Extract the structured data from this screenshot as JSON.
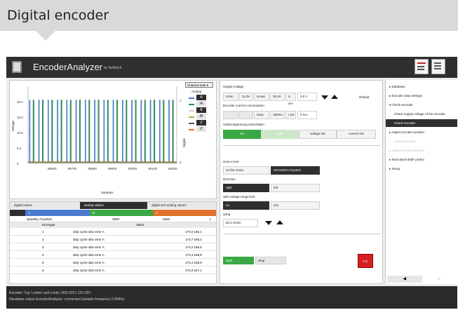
{
  "banner": {
    "title": "Digital encoder"
  },
  "app": {
    "name": "EncoderAnalyzer",
    "by": "by Schleich"
  },
  "plot": {
    "channel_select": "Channel sele ▾",
    "legend_title": "Analog",
    "y_label": "Voltage",
    "x_label": "Samples",
    "right_label": "Digital",
    "legend": [
      {
        "label": "A",
        "color": "#4a7bd0"
      },
      {
        "label": "/A",
        "color": "#2e8b57"
      },
      {
        "label": "B",
        "color": "#cfcfcf"
      },
      {
        "label": "/B",
        "color": "#8fbc3f"
      },
      {
        "label": "Z",
        "color": "#555555"
      },
      {
        "label": "/Z",
        "color": "#e0702a"
      }
    ]
  },
  "chart_data": {
    "type": "line",
    "xlabel": "Samples",
    "ylabel": "Voltage",
    "ylim": [
      0,
      25
    ],
    "yticks": [
      "20.0",
      "15.0",
      "10.0",
      "5.0",
      "0"
    ],
    "xticks": [
      "89600",
      "89700",
      "89800",
      "89900",
      "90000",
      "90100",
      "90200"
    ],
    "right_ticks": [
      "1",
      "0"
    ],
    "series": [
      {
        "name": "A",
        "color": "#4a7bd0",
        "low": 0.3,
        "high": 20.5,
        "period": 10
      },
      {
        "name": "/A",
        "color": "#2e8b57",
        "low": 0.3,
        "high": 20.5,
        "period": 10,
        "phase": 5
      },
      {
        "name": "Z",
        "color": "#e0702a",
        "low": 0.5,
        "high": 0.5
      }
    ]
  },
  "data_tabs": [
    "digital values",
    "analog values",
    "digital and analog values"
  ],
  "channels": [
    {
      "label": "A",
      "color": "#4a7bd0"
    },
    {
      "label": "B",
      "color": "#3aa845"
    },
    {
      "label": "Z",
      "color": "#e0702a"
    }
  ],
  "quantity": {
    "label": "Quantity of pulses",
    "v1": "2500",
    "v2": "2500",
    "v3": "1"
  },
  "table_header": {
    "type": "Errortype",
    "value": "Value"
  },
  "error_rows": [
    {
      "num": "1",
      "type": "duty cycle ratio error A",
      "value": "174,0 166,1"
    },
    {
      "num": "2",
      "type": "duty cycle ratio error A",
      "value": "174,7 166,3"
    },
    {
      "num": "3",
      "type": "duty cycle ratio error A",
      "value": "174,2 166,6"
    },
    {
      "num": "4",
      "type": "duty cycle ratio error A",
      "value": "173,4 166,8"
    },
    {
      "num": "5",
      "type": "duty cycle ratio error A",
      "value": "173,4 166,8"
    },
    {
      "num": "6",
      "type": "duty cycle ratio error A",
      "value": "172,9 167,1"
    }
  ],
  "supply": {
    "title": "Supply voltage",
    "umin_label": "Umin",
    "umin": "11.0V",
    "umax_label": "Umax",
    "umax": "30.0V",
    "uset_label": "U set",
    "uset": "0.0 V",
    "default": "Default",
    "current_title": "Encoder current consumption",
    "imax_label": "Imax",
    "imax": "150mA",
    "iset_label": "I act",
    "iset": "0 mA",
    "gate_title": "Gebernspannung einschalten",
    "on": "On",
    "off": "Off",
    "voltage_ok": "voltage OK",
    "current_ok": "current OK"
  },
  "test": {
    "title": "How to test",
    "motor": "on the motor",
    "system": "SCHLEICH-System",
    "direction_title": "Direction",
    "right": "right",
    "left": "left",
    "range_title": "with voltage-range test",
    "no": "no",
    "yes": "yes",
    "rpm_title": "rpmg",
    "rpm": "83.3 U/min",
    "start": "Start",
    "stop": "Stop",
    "red": "n.G."
  },
  "nav": [
    {
      "label": "▸ Database",
      "cls": ""
    },
    {
      "label": "▸ Encoder data settings",
      "cls": ""
    },
    {
      "label": "▾ Check encoder",
      "cls": ""
    },
    {
      "label": "Check supply voltage of the encoder",
      "cls": "sub"
    },
    {
      "label": "Check encoder",
      "cls": "sub active"
    },
    {
      "label": "▸ Adjust encoder position",
      "cls": ""
    },
    {
      "label": "Check resolver",
      "cls": "sub disabled"
    },
    {
      "label": "▸ Adjust resolver position",
      "cls": "disabled"
    },
    {
      "label": "▸ Moto-Back-EMF prüfen",
      "cls": ""
    },
    {
      "label": "▸ Setup",
      "cls": ""
    }
  ],
  "status": {
    "line1": "Encoder: Typ: Leitner und Linde | RGI 503 | 12V-30V",
    "line2": "Hardware status EncoderAnalyzer: connected (sample frequency 2.5MHz)"
  }
}
